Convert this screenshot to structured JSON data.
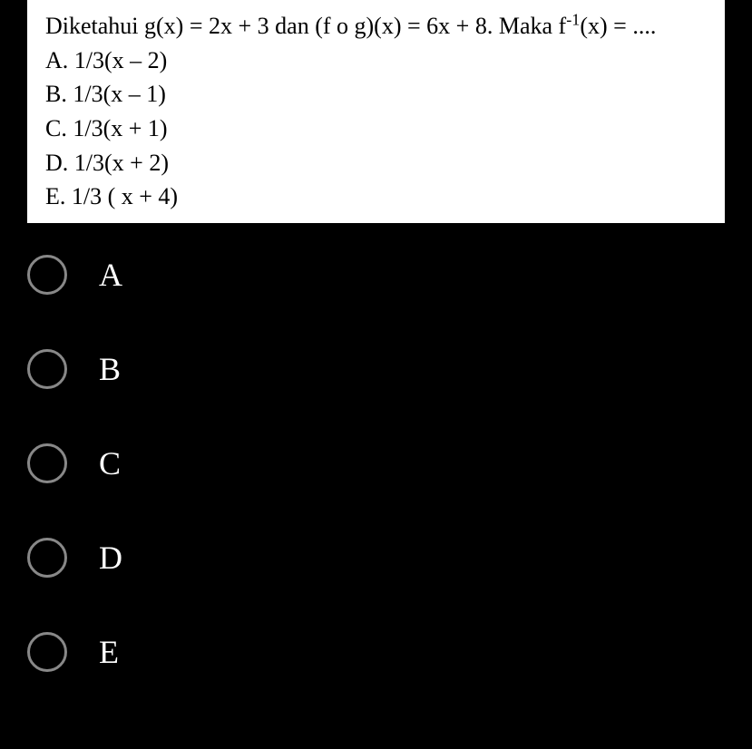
{
  "question": {
    "prompt_before_sup": "Diketahui g(x) = 2x + 3 dan (f o g)(x) = 6x + 8. Maka f",
    "sup": "-1",
    "prompt_after_sup": "(x) = ....",
    "choices": [
      {
        "letter": "A.",
        "text": "1/3(x – 2)"
      },
      {
        "letter": "B.",
        "text": "1/3(x – 1)"
      },
      {
        "letter": "C.",
        "text": "1/3(x + 1)"
      },
      {
        "letter": "D.",
        "text": "1/3(x + 2)"
      },
      {
        "letter": "E.",
        "text": "1/3 ( x + 4)"
      }
    ]
  },
  "options": [
    {
      "label": "A"
    },
    {
      "label": "B"
    },
    {
      "label": "C"
    },
    {
      "label": "D"
    },
    {
      "label": "E"
    }
  ]
}
